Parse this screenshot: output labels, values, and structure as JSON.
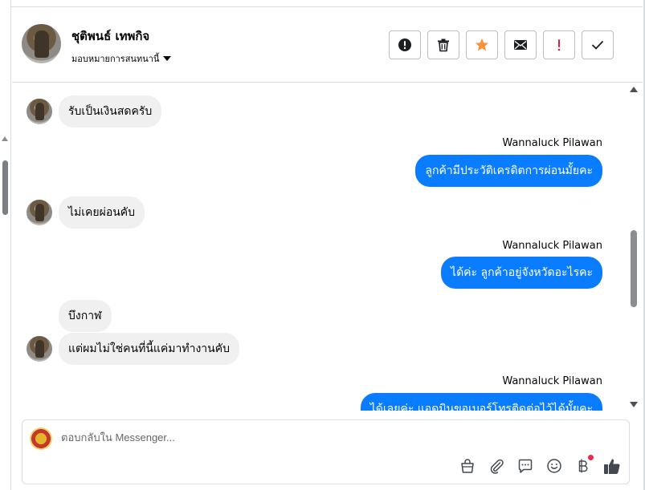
{
  "header": {
    "contact_name": "ชุติพนธ์ เทพกิจ",
    "assign_label": "มอบหมายการสนทนานี้",
    "actions": [
      {
        "name": "spam-button",
        "icon": "exclamation-circle-icon"
      },
      {
        "name": "delete-button",
        "icon": "trash-icon"
      },
      {
        "name": "star-button",
        "icon": "star-icon"
      },
      {
        "name": "mark-unread-button",
        "icon": "envelope-icon"
      },
      {
        "name": "follow-up-button",
        "icon": "exclamation-icon"
      },
      {
        "name": "mark-done-button",
        "icon": "checkmark-icon"
      }
    ]
  },
  "messages": [
    {
      "dir": "in",
      "text": "รับเป็นเงินสดครับ",
      "avatar": true
    },
    {
      "dir": "out",
      "sender": "Wannaluck Pilawan",
      "text": "ลูกค้ามีประวัติเครดิตการผ่อนมั้ยคะ"
    },
    {
      "dir": "in",
      "text": "ไม่เคยผ่อนคับ",
      "avatar": true
    },
    {
      "dir": "out",
      "sender": "Wannaluck Pilawan",
      "text": "ได้ค่ะ  ลูกค้าอยู่จังหวัดอะไรคะ"
    },
    {
      "dir": "in",
      "text": "บึงกาฬ",
      "avatar": false
    },
    {
      "dir": "in",
      "text": "แต่ผมไม่ใช่คนที่นี้แค่มาทำงานคับ",
      "avatar": true
    },
    {
      "dir": "out",
      "sender": "Wannaluck Pilawan",
      "text": "ได้เลยค่ะ แอดมินขอเบอร์โทรติดต่อไว้ได้มั้ยคะ"
    }
  ],
  "composer": {
    "placeholder": "ตอบกลับใน Messenger...",
    "tools": [
      "shopping-bag-icon",
      "paperclip-icon",
      "saved-reply-icon",
      "emoji-icon",
      "baht-payment-icon",
      "thumbs-up-icon"
    ]
  },
  "colors": {
    "outgoing_bubble": "#0a7cff",
    "incoming_bubble": "#f0f0f0",
    "star": "#f7923b",
    "follow_up": "#e41e3f"
  }
}
